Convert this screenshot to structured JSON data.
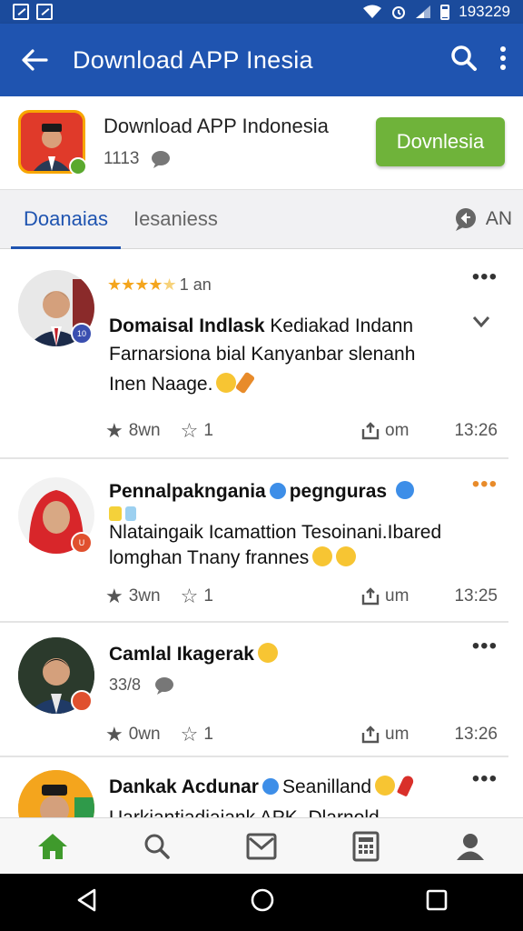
{
  "status_bar": {
    "time": "193229"
  },
  "app_bar": {
    "title": "Download APP Inesia"
  },
  "app_header": {
    "name": "Download APP Indonesia",
    "sub": "1113",
    "install_label": "Dovnlesia"
  },
  "tabs": [
    {
      "label": "Doanaias",
      "active": true
    },
    {
      "label": "Iesaniess",
      "active": false
    }
  ],
  "tabs_right_label": "AN",
  "posts": [
    {
      "rating_text": "1 an",
      "title_bold": "Domaisal Indlask",
      "title_rest": " Kediakad Indann",
      "body_line1": "Farnarsiona bial Kanyanbar slenanh",
      "body_line2": "Inen Naage.",
      "likes": "8wn",
      "stars": "1",
      "share": "om",
      "time": "13:26",
      "avatar_badge": "10"
    },
    {
      "title_bold": "Pennalpakngania",
      "title_rest": "pegnguras",
      "body_line1": "Nlataingaik Icamattion Tesoinani.Ibared",
      "body_line2": "lomghan Tnany frannes",
      "likes": "3wn",
      "stars": "1",
      "share": "um",
      "time": "13:25",
      "avatar_badge": "U"
    },
    {
      "title_bold": "Camlal Ikagerak",
      "sub_count": "33/8",
      "likes": "0wn",
      "stars": "1",
      "share": "um",
      "time": "13:26"
    },
    {
      "title_bold": "Dankak Acdunar",
      "title_rest": "Seanilland",
      "body_line1": "Uarkiantiadiaiank APK. Dlarnold"
    }
  ],
  "colors": {
    "primary": "#1f54b0",
    "install": "#6fb33a",
    "verified": "#3d8ee8"
  },
  "bottom_nav_icons": [
    "home-icon",
    "search-icon",
    "mail-icon",
    "calculator-icon",
    "profile-icon"
  ]
}
